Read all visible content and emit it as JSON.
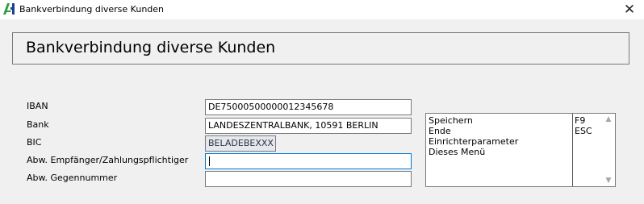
{
  "window": {
    "title": "Bankverbindung diverse Kunden",
    "logo_icon": "app-logo-icon",
    "close_glyph": "✕"
  },
  "header": {
    "title": "Bankverbindung diverse Kunden"
  },
  "form": {
    "iban": {
      "label": "IBAN",
      "value": "DE75000500000012345678"
    },
    "bank": {
      "label": "Bank",
      "value": "LANDESZENTRALBANK, 10591 BERLIN"
    },
    "bic": {
      "label": "BIC",
      "value": "BELADEBEXXX"
    },
    "abw_empfaenger": {
      "label": "Abw. Empfänger/Zahlungspflichtiger",
      "value": ""
    },
    "abw_gegennummer": {
      "label": "Abw. Gegennummer",
      "value": ""
    }
  },
  "menu": {
    "items": [
      {
        "label": "Speichern",
        "key": "F9"
      },
      {
        "label": "Ende",
        "key": "ESC"
      },
      {
        "label": "Einrichterparameter",
        "key": ""
      },
      {
        "label": "Dieses Menü",
        "key": ""
      }
    ],
    "scroll_up_glyph": "▲",
    "scroll_down_glyph": "▼"
  },
  "colors": {
    "focus_border": "#0078d7",
    "bic_background": "#e3e8f1",
    "logo_green": "#2e9e3e",
    "logo_blue": "#1f3f8f"
  }
}
